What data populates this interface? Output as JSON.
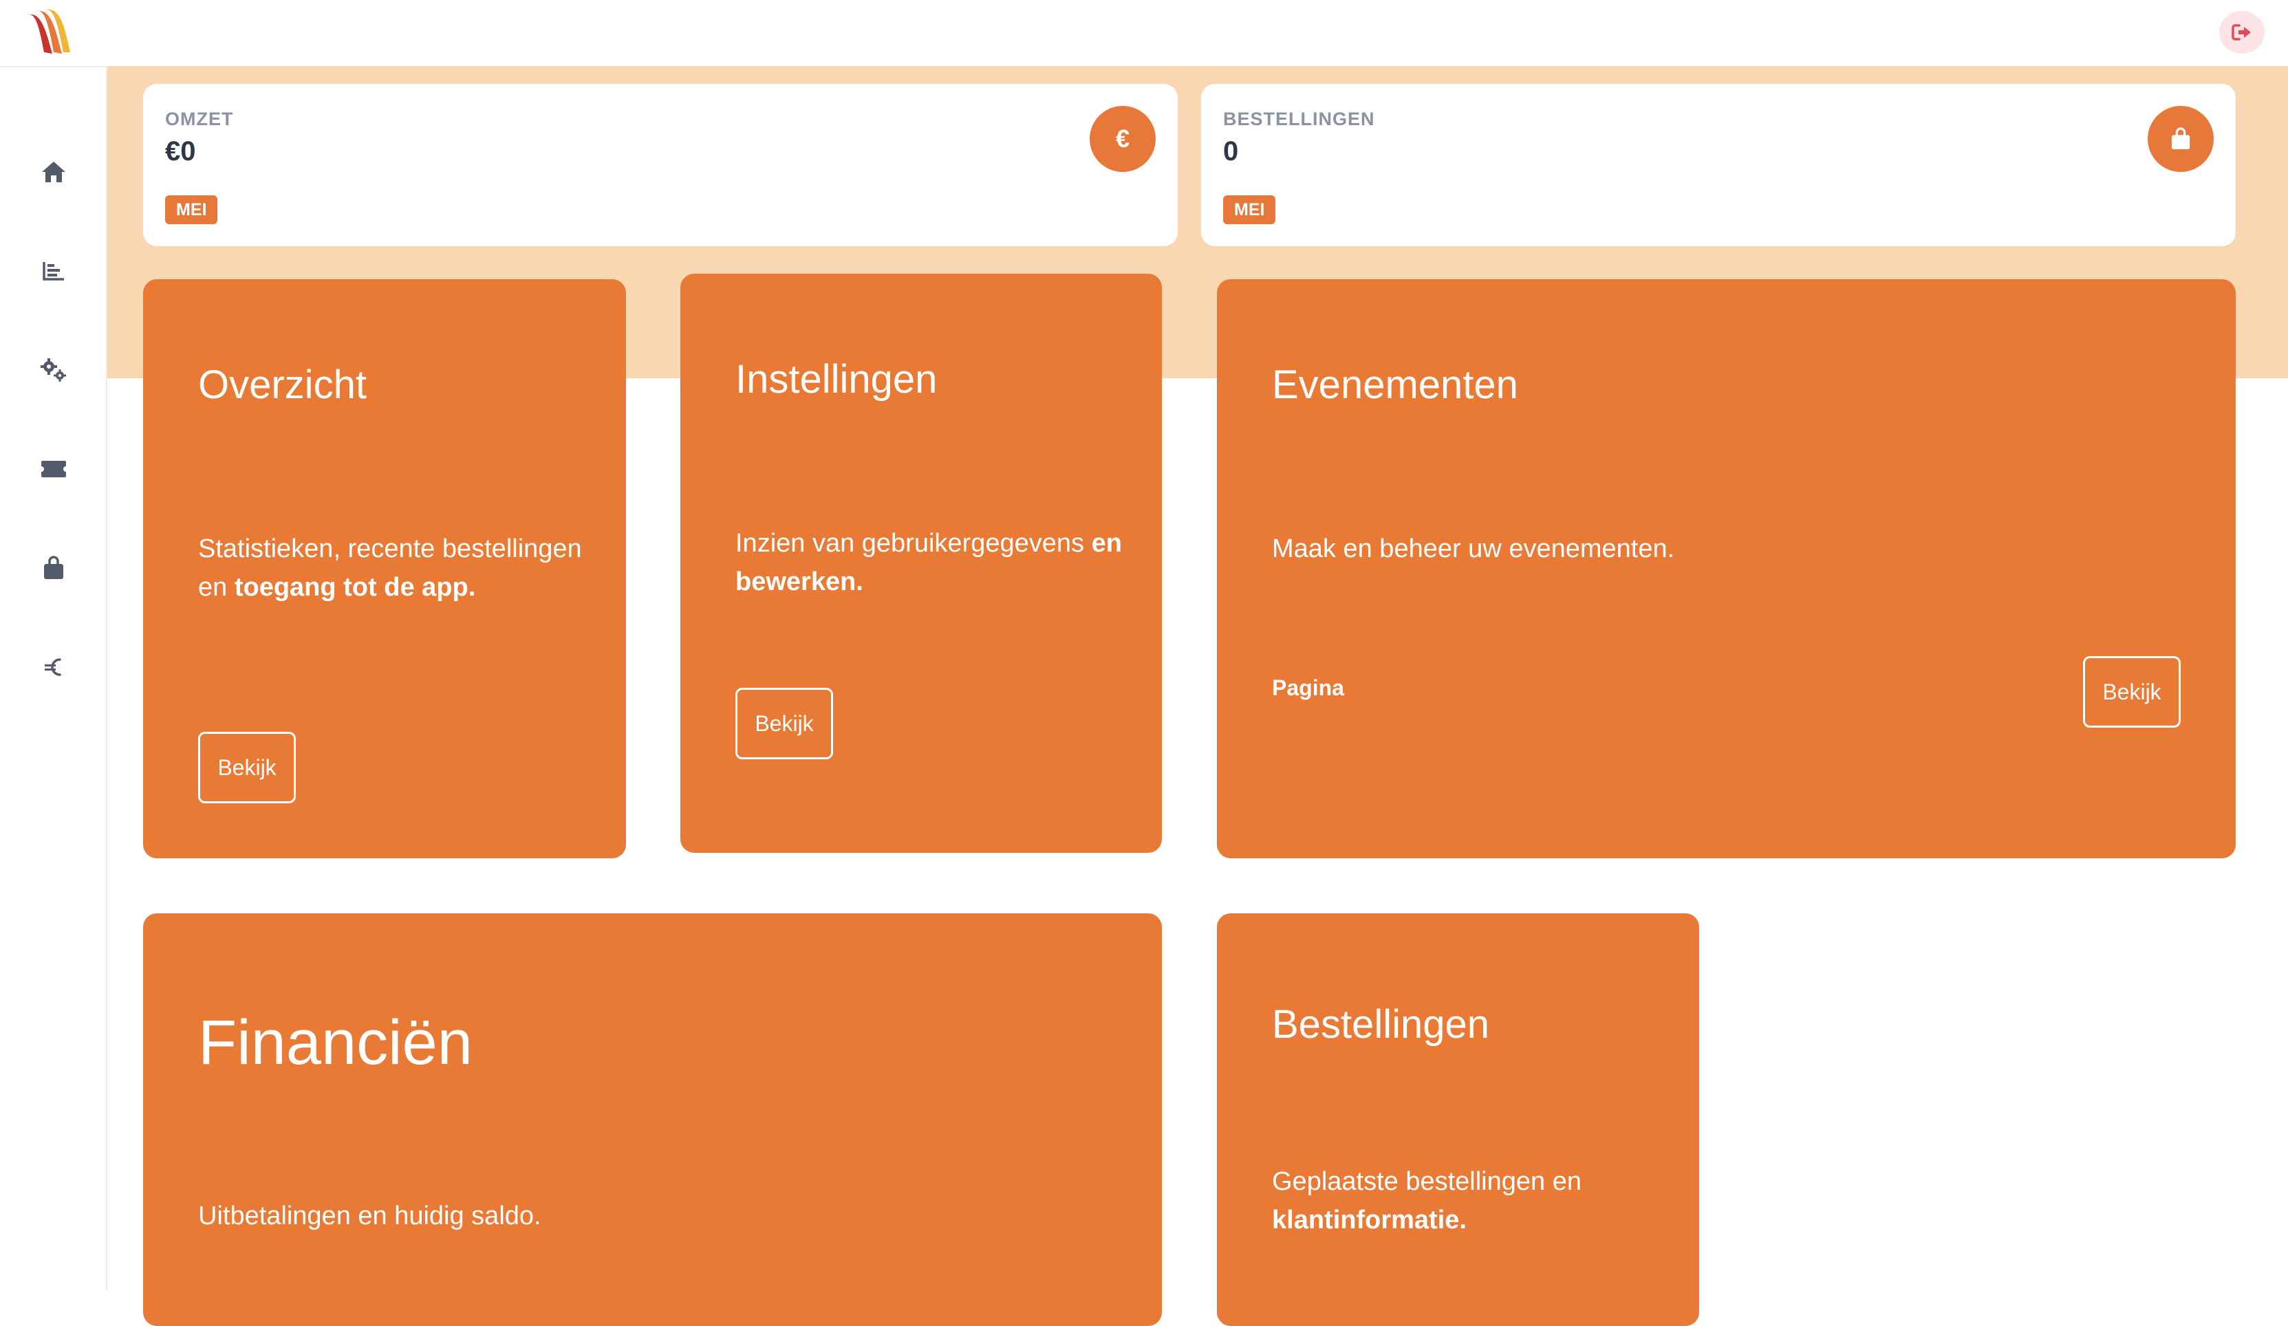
{
  "colors": {
    "accent": "#e8783a",
    "tile": "#e87a36",
    "band": "#f8d7b2",
    "logout_bg": "#fbe3e6",
    "logout_icon": "#e04a5a"
  },
  "header": {
    "logout_icon": "sign-out-icon"
  },
  "sidebar": {
    "items": [
      {
        "icon": "home-icon"
      },
      {
        "icon": "bar-chart-icon"
      },
      {
        "icon": "cogs-icon"
      },
      {
        "icon": "ticket-icon"
      },
      {
        "icon": "shopping-bag-icon"
      },
      {
        "icon": "euro-icon"
      }
    ]
  },
  "stats": [
    {
      "label": "OMZET",
      "value": "€0",
      "badge": "MEI",
      "icon": "euro-icon",
      "icon_glyph": "€"
    },
    {
      "label": "BESTELLINGEN",
      "value": "0",
      "badge": "MEI",
      "icon": "shopping-bag-icon"
    }
  ],
  "tiles": {
    "overzicht": {
      "title": "Overzicht",
      "desc_prefix": "Statistieken, recente bestellingen en ",
      "desc_bold": "toegang tot de app.",
      "button": "Bekijk"
    },
    "instellingen": {
      "title": "Instellingen",
      "desc_prefix": "Inzien van gebruikergegevens ",
      "desc_bold": "en bewerken.",
      "button": "Bekijk"
    },
    "evenementen": {
      "title": "Evenementen",
      "desc": "Maak en beheer uw evenementen.",
      "footer_label": "Pagina",
      "button": "Bekijk"
    },
    "financien": {
      "title": "Financiën",
      "desc": "Uitbetalingen en huidig saldo."
    },
    "bestellingen": {
      "title": "Bestellingen",
      "desc_prefix": "Geplaatste bestellingen en ",
      "desc_bold": "klantinformatie."
    }
  }
}
